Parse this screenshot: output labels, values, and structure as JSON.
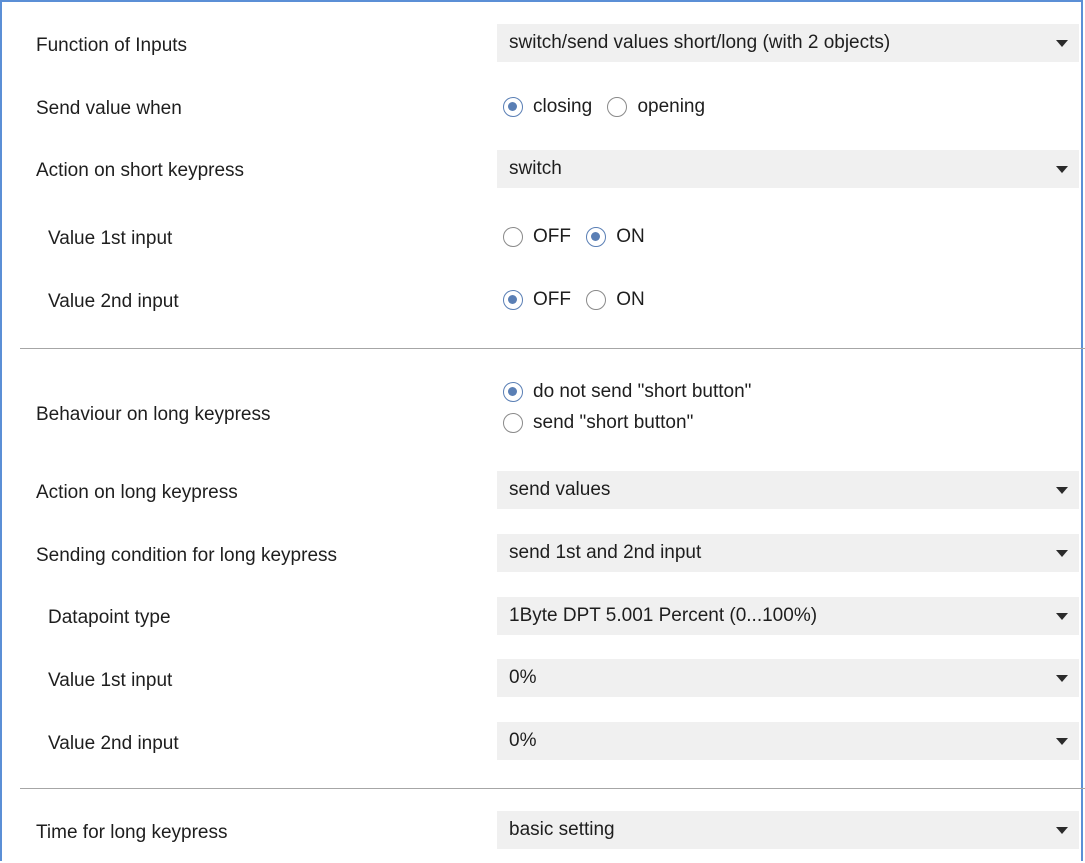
{
  "fields": {
    "function_of_inputs": {
      "label": "Function of Inputs",
      "value": "switch/send values short/long (with 2 objects)"
    },
    "send_value_when": {
      "label": "Send value when",
      "options": [
        "closing",
        "opening"
      ],
      "selected": "closing"
    },
    "action_short": {
      "label": "Action on short keypress",
      "value": "switch"
    },
    "short_value_1": {
      "label": "Value 1st input",
      "options": [
        "OFF",
        "ON"
      ],
      "selected": "ON"
    },
    "short_value_2": {
      "label": "Value 2nd input",
      "options": [
        "OFF",
        "ON"
      ],
      "selected": "OFF"
    },
    "behaviour_long": {
      "label": "Behaviour on long keypress",
      "options": [
        "do not send \"short button\"",
        "send \"short button\""
      ],
      "selected": "do not send \"short button\""
    },
    "action_long": {
      "label": "Action on long keypress",
      "value": "send values"
    },
    "sending_condition": {
      "label": "Sending condition for long keypress",
      "value": "send 1st and 2nd input"
    },
    "datapoint_type": {
      "label": "Datapoint type",
      "value": "1Byte DPT 5.001 Percent (0...100%)"
    },
    "long_value_1": {
      "label": "Value 1st input",
      "value": "0%"
    },
    "long_value_2": {
      "label": "Value 2nd input",
      "value": "0%"
    },
    "time_long": {
      "label": "Time for long keypress",
      "value": "basic setting"
    }
  },
  "icons": {
    "dropdown": "chevron-down-icon"
  },
  "colors": {
    "frame": "#5b8fd6",
    "radio_checked": "#5a7fb5",
    "select_bg": "#f0f0f0"
  }
}
